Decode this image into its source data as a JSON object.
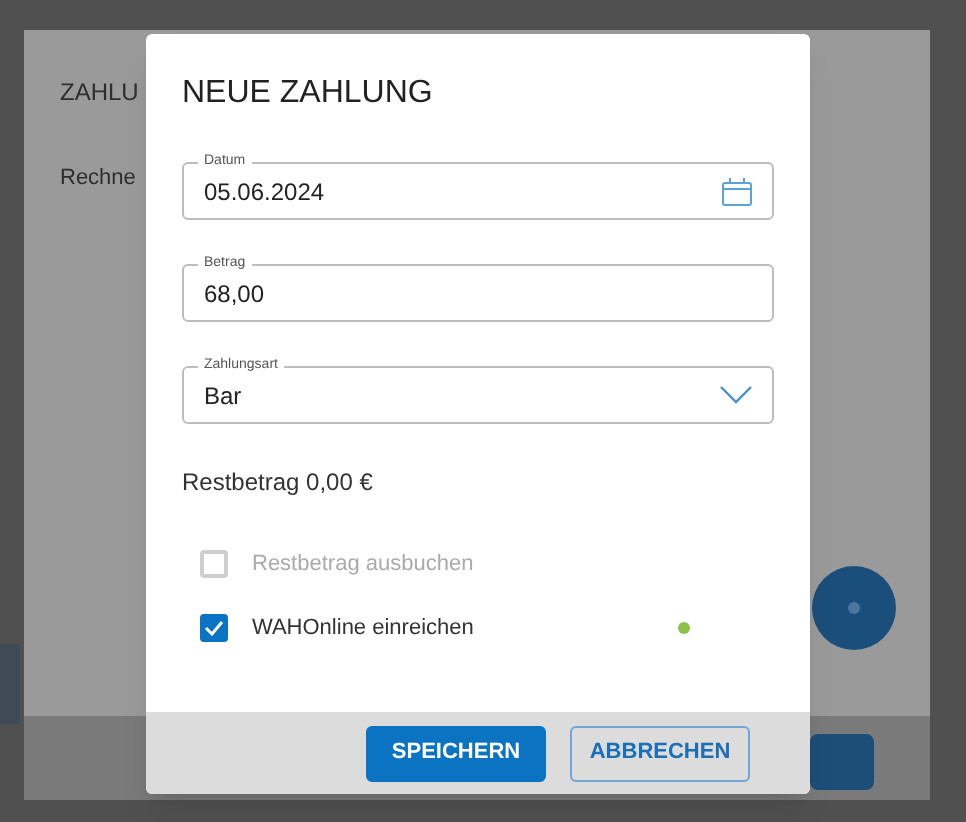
{
  "background": {
    "title": "ZAHLU",
    "text": "Rechne"
  },
  "dialog": {
    "title": "NEUE ZAHLUNG",
    "fields": [
      {
        "kind": "date",
        "label": "Datum",
        "value": "05.06.2024"
      },
      {
        "kind": "text",
        "label": "Betrag",
        "value": "68,00"
      },
      {
        "kind": "select",
        "label": "Zahlungsart",
        "value": "Bar"
      }
    ],
    "remaining": "Restbetrag 0,00 €",
    "options": [
      {
        "label": "Restbetrag ausbuchen",
        "checked": false,
        "disabled": true
      },
      {
        "label": "WAHOnline einreichen",
        "checked": true,
        "disabled": false,
        "color": "#8bc34a"
      }
    ],
    "buttons": [
      {
        "label": "SPEICHERN",
        "kind": "primary"
      },
      {
        "label": "ABBRECHEN",
        "kind": "secondary"
      }
    ]
  }
}
